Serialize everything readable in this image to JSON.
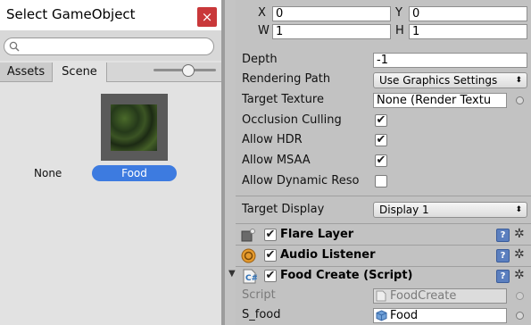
{
  "dialog": {
    "title": "Select GameObject",
    "close_glyph": "×",
    "search": {
      "value": "",
      "placeholder": ""
    },
    "tabs": [
      "Assets",
      "Scene"
    ],
    "items": [
      {
        "label": "None",
        "selected": false
      },
      {
        "label": "Food",
        "selected": true
      }
    ]
  },
  "inspector": {
    "rect": {
      "x_label": "X",
      "x_value": "0",
      "y_label": "Y",
      "y_value": "0",
      "w_label": "W",
      "w_value": "1",
      "h_label": "H",
      "h_value": "1"
    },
    "depth": {
      "label": "Depth",
      "value": "-1"
    },
    "rendering_path": {
      "label": "Rendering Path",
      "value": "Use Graphics Settings"
    },
    "target_texture": {
      "label": "Target Texture",
      "value": "None (Render Textu"
    },
    "occlusion_culling": {
      "label": "Occlusion Culling",
      "checked": true
    },
    "allow_hdr": {
      "label": "Allow HDR",
      "checked": true
    },
    "allow_msaa": {
      "label": "Allow MSAA",
      "checked": true
    },
    "allow_dynamic": {
      "label": "Allow Dynamic Reso",
      "checked": false
    },
    "target_display": {
      "label": "Target Display",
      "value": "Display 1"
    },
    "components": [
      {
        "name": "Flare Layer",
        "enabled": true
      },
      {
        "name": "Audio Listener",
        "enabled": true
      },
      {
        "name": "Food Create (Script)",
        "enabled": true
      }
    ],
    "script": {
      "label": "Script",
      "value": "FoodCreate"
    },
    "s_food": {
      "label": "S_food",
      "value": "Food"
    }
  },
  "glyphs": {
    "check": "✔",
    "caret": "⬍",
    "foldout": "▼",
    "gear": "✲",
    "help": "?"
  },
  "colors": {
    "selection": "#3d7be0",
    "close": "#c9383a",
    "panel": "#c2c2c2"
  }
}
